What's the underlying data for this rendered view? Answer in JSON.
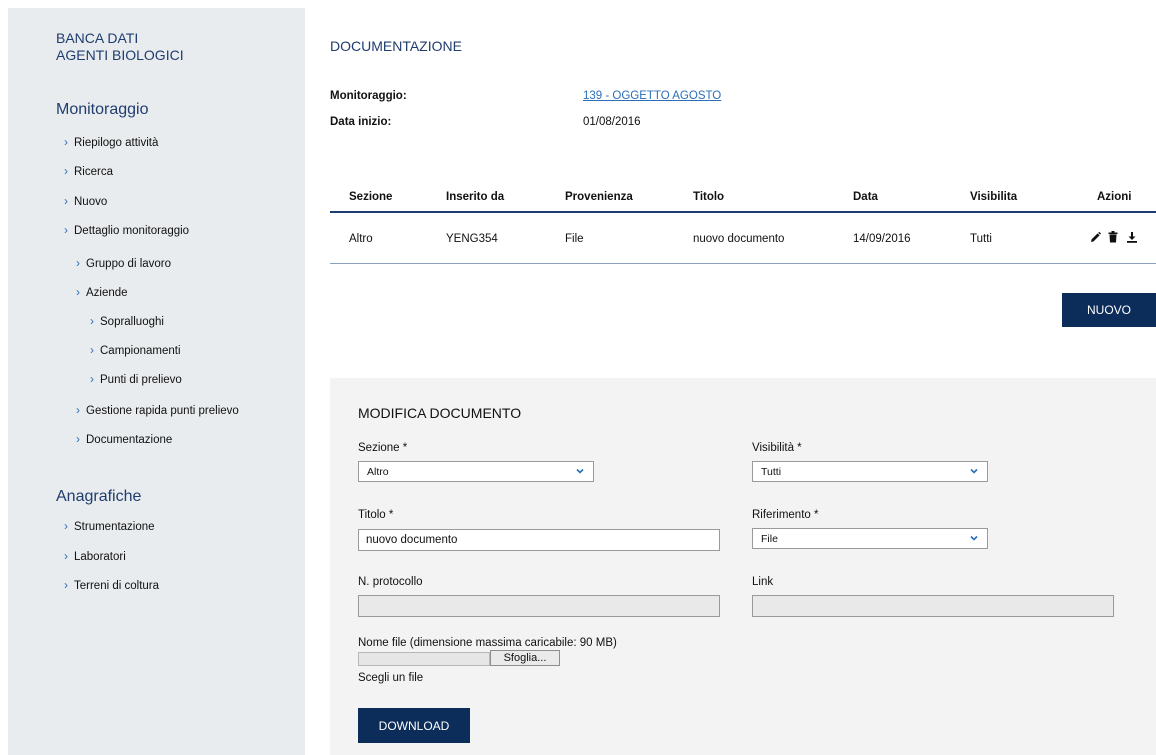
{
  "sidebar": {
    "brand_line1": "BANCA DATI",
    "brand_line2": "AGENTI BIOLOGICI",
    "section1_title": "Monitoraggio",
    "section1_items": [
      "Riepilogo attività",
      "Ricerca",
      "Nuovo",
      "Dettaglio monitoraggio",
      "Gruppo di lavoro",
      "Aziende",
      "Sopralluoghi",
      "Campionamenti",
      "Punti di prelievo",
      "Gestione rapida punti prelievo",
      "Documentazione"
    ],
    "section2_title": "Anagrafiche",
    "section2_items": [
      "Strumentazione",
      "Laboratori",
      "Terreni di coltura"
    ],
    "chevron_glyph": "›"
  },
  "main": {
    "page_title": "DOCUMENTAZIONE",
    "monitoraggio_label": "Monitoraggio:",
    "monitoraggio_value": "139 - OGGETTO AGOSTO",
    "data_inizio_label": "Data inizio:",
    "data_inizio_value": "01/08/2016",
    "table": {
      "headers": [
        "Sezione",
        "Inserito da",
        "Provenienza",
        "Titolo",
        "Data",
        "Visibilita",
        "Azioni"
      ],
      "rows": [
        [
          "Altro",
          "YENG354",
          "File",
          "nuovo documento",
          "14/09/2016",
          "Tutti"
        ]
      ],
      "action_icons": [
        "pencil-icon",
        "trash-icon",
        "download-icon"
      ]
    },
    "nuovo_label": "NUOVO"
  },
  "form": {
    "title": "MODIFICA DOCUMENTO",
    "sezione_label": "Sezione *",
    "sezione_value": "Altro",
    "visibilita_label": "Visibilità *",
    "visibilita_value": "Tutti",
    "titolo_label": "Titolo *",
    "titolo_value": "nuovo documento",
    "riferimento_label": "Riferimento *",
    "riferimento_value": "File",
    "protocollo_label": "N. protocollo",
    "protocollo_value": "",
    "link_label": "Link",
    "link_value": "",
    "file_label": "Nome file (dimensione massima caricabile: 90 MB)",
    "browse_label": "Sfoglia...",
    "file_status": "Scegli un file",
    "download_label": "DOWNLOAD"
  },
  "colors": {
    "brand_navy": "#1f3d6e",
    "button_navy": "#0c2d5a",
    "link_blue": "#2a6fb8",
    "sidebar_bg": "#e9ecee",
    "panel_bg": "#f3f3f3"
  }
}
